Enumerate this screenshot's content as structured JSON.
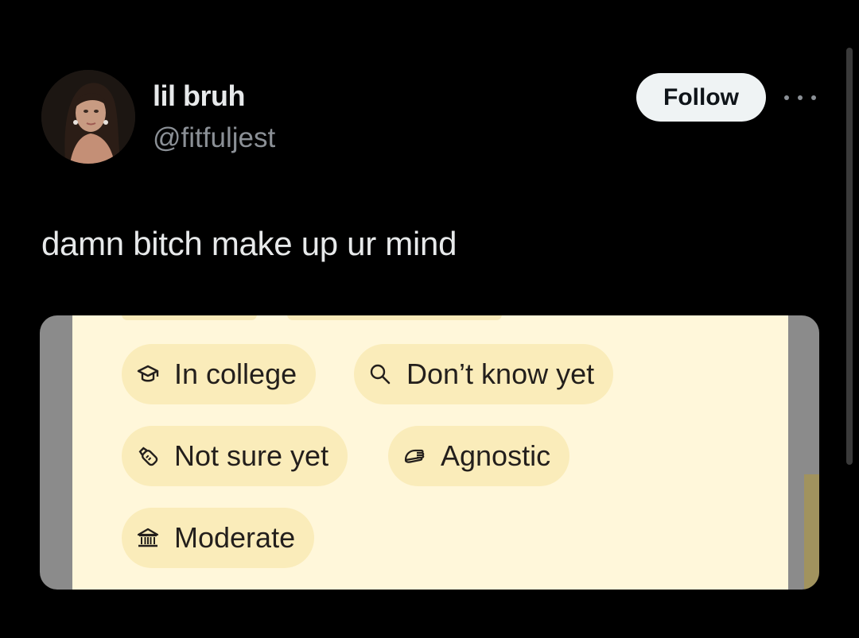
{
  "post": {
    "display_name": "lil bruh",
    "handle": "@fitfuljest",
    "follow_label": "Follow",
    "text": "damn bitch make up ur mind"
  },
  "profile_chips": [
    {
      "label": "In college",
      "icon": "graduation-cap-icon"
    },
    {
      "label": "Don’t know yet",
      "icon": "magnifier-icon"
    },
    {
      "label": "Not sure yet",
      "icon": "baby-bottle-icon"
    },
    {
      "label": "Agnostic",
      "icon": "praying-hands-icon"
    },
    {
      "label": "Moderate",
      "icon": "government-building-icon"
    }
  ],
  "colors": {
    "background": "#000000",
    "primary_text": "#e7e9ea",
    "secondary_text": "#8b9096",
    "follow_button_bg": "#eff3f4",
    "card_bg": "#fff7da",
    "chip_bg": "#faecba",
    "chip_text": "#231f1c"
  }
}
